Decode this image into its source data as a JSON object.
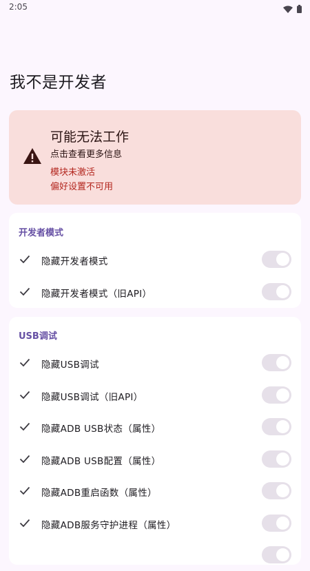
{
  "status_bar": {
    "time": "2:05",
    "icons": [
      "wifi-icon",
      "battery-icon"
    ]
  },
  "page_title": "我不是开发者",
  "warning": {
    "icon": "warning-triangle-icon",
    "title": "可能无法工作",
    "subtitle": "点击查看更多信息",
    "errors": [
      "模块未激活",
      "偏好设置不可用"
    ],
    "colors": {
      "background": "#F9DEDC",
      "error_text": "#B3261E"
    }
  },
  "groups": [
    {
      "title": "开发者模式",
      "items": [
        {
          "label": "隐藏开发者模式",
          "checked": true,
          "enabled": false
        },
        {
          "label": "隐藏开发者模式（旧API）",
          "checked": true,
          "enabled": false
        }
      ]
    },
    {
      "title": "USB调试",
      "items": [
        {
          "label": "隐藏USB调试",
          "checked": true,
          "enabled": false
        },
        {
          "label": "隐藏USB调试（旧API）",
          "checked": true,
          "enabled": false
        },
        {
          "label": "隐藏ADB USB状态（属性）",
          "checked": true,
          "enabled": false
        },
        {
          "label": "隐藏ADB USB配置（属性）",
          "checked": true,
          "enabled": false
        },
        {
          "label": "隐藏ADB重启函数（属性）",
          "checked": true,
          "enabled": false
        },
        {
          "label": "隐藏ADB服务守护进程（属性）",
          "checked": true,
          "enabled": false
        }
      ]
    }
  ],
  "colors": {
    "accent": "#6650A4",
    "page_background": "#FCF6FE",
    "card_background": "#FFFFFF"
  }
}
